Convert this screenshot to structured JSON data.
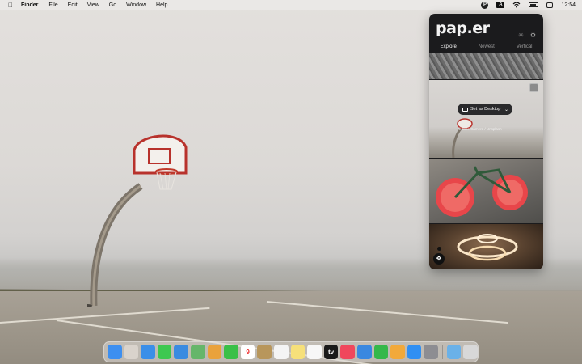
{
  "menubar": {
    "app_name": "Finder",
    "items": [
      "File",
      "Edit",
      "View",
      "Go",
      "Window",
      "Help"
    ],
    "status": {
      "paper_icon": "P",
      "input_source": "A",
      "time": "12:54"
    }
  },
  "popover": {
    "logo": "pap.er",
    "tabs": [
      {
        "label": "Explore",
        "active": true
      },
      {
        "label": "Newest",
        "active": false
      },
      {
        "label": "Vertical",
        "active": false
      }
    ],
    "set_desktop_label": "Set as Desktop",
    "credit": "© Cole Camera / Unsplash"
  },
  "dock": {
    "apps": [
      {
        "name": "Finder",
        "icon": "finder-icon",
        "color": "#3d8ff0"
      },
      {
        "name": "Launchpad",
        "icon": "launchpad-icon",
        "color": "#d9d3cc"
      },
      {
        "name": "Safari",
        "icon": "safari-icon",
        "color": "#3b8fe8"
      },
      {
        "name": "Messages",
        "icon": "messages-icon",
        "color": "#3dc850"
      },
      {
        "name": "Mail",
        "icon": "mail-icon",
        "color": "#3a8be0"
      },
      {
        "name": "Maps",
        "icon": "maps-icon",
        "color": "#66b66a"
      },
      {
        "name": "Photos",
        "icon": "photos-icon",
        "color": "#e9a23c"
      },
      {
        "name": "FaceTime",
        "icon": "facetime-icon",
        "color": "#39c048"
      },
      {
        "name": "Calendar",
        "icon": "calendar-icon",
        "color": "#ffffff",
        "label": "9"
      },
      {
        "name": "Contacts",
        "icon": "contacts-icon",
        "color": "#b8965b"
      },
      {
        "name": "Reminders",
        "icon": "reminders-icon",
        "color": "#f4f4f4"
      },
      {
        "name": "Notes",
        "icon": "notes-icon",
        "color": "#f6e07a"
      },
      {
        "name": "Freeform",
        "icon": "freeform-icon",
        "color": "#f7f7f7"
      },
      {
        "name": "TV",
        "icon": "tv-icon",
        "color": "#1a1a1a",
        "label": "tv"
      },
      {
        "name": "Music",
        "icon": "music-icon",
        "color": "#f0475c"
      },
      {
        "name": "Keynote",
        "icon": "keynote-icon",
        "color": "#3a88e0"
      },
      {
        "name": "Numbers",
        "icon": "numbers-icon",
        "color": "#35b84a"
      },
      {
        "name": "Pages",
        "icon": "pages-icon",
        "color": "#f2a93a"
      },
      {
        "name": "App Store",
        "icon": "appstore-icon",
        "color": "#2f8ff3"
      },
      {
        "name": "System Settings",
        "icon": "settings-icon",
        "color": "#8d8d92"
      },
      {
        "name": "Downloads",
        "icon": "downloads-folder-icon",
        "color": "#6ab1e8"
      },
      {
        "name": "Trash",
        "icon": "trash-icon",
        "color": "#d8d8d8"
      }
    ]
  }
}
